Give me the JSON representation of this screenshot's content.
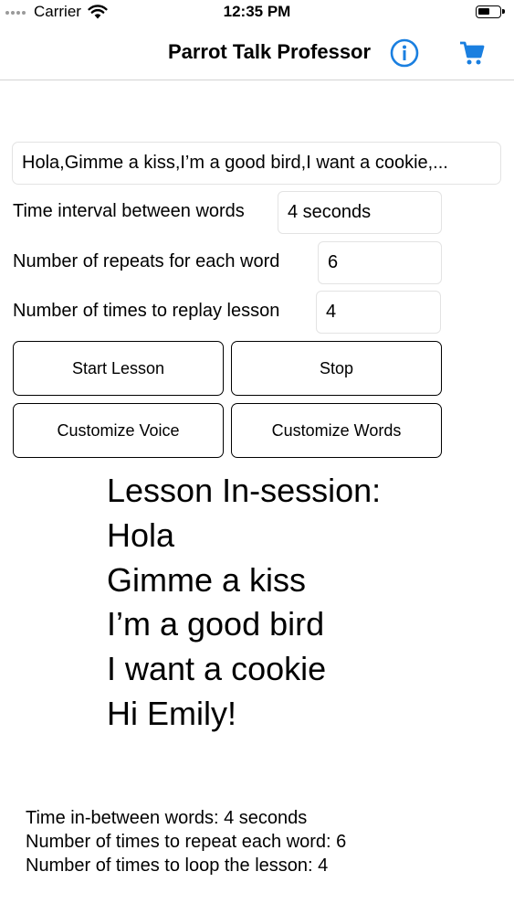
{
  "status_bar": {
    "carrier": "Carrier",
    "time": "12:35 PM",
    "wifi_icon": "wifi-icon",
    "battery_icon": "battery-icon"
  },
  "nav": {
    "title": "Parrot Talk Professor",
    "info_icon": "info-icon",
    "cart_icon": "cart-icon",
    "accent_color": "#1a7fe0"
  },
  "form": {
    "words_value": "Hola,Gimme a kiss,I’m a good bird,I want a cookie,...",
    "interval_label": "Time interval between words",
    "interval_value": "4 seconds",
    "repeats_label": "Number of repeats for each word",
    "repeats_value": "6",
    "replays_label": "Number of times to replay lesson",
    "replays_value": "4"
  },
  "buttons": {
    "start": "Start Lesson",
    "stop": "Stop",
    "customize_voice": "Customize Voice",
    "customize_words": "Customize Words"
  },
  "lesson": {
    "heading": "Lesson In-session:",
    "words": [
      "Hola",
      "Gimme a kiss",
      "I’m a good bird",
      "I want a cookie",
      "Hi Emily!"
    ]
  },
  "summary": {
    "interval": "Time in-between words: 4 seconds",
    "repeats": "Number of times to repeat each word: 6",
    "loops": "Number of times to loop the lesson: 4"
  }
}
